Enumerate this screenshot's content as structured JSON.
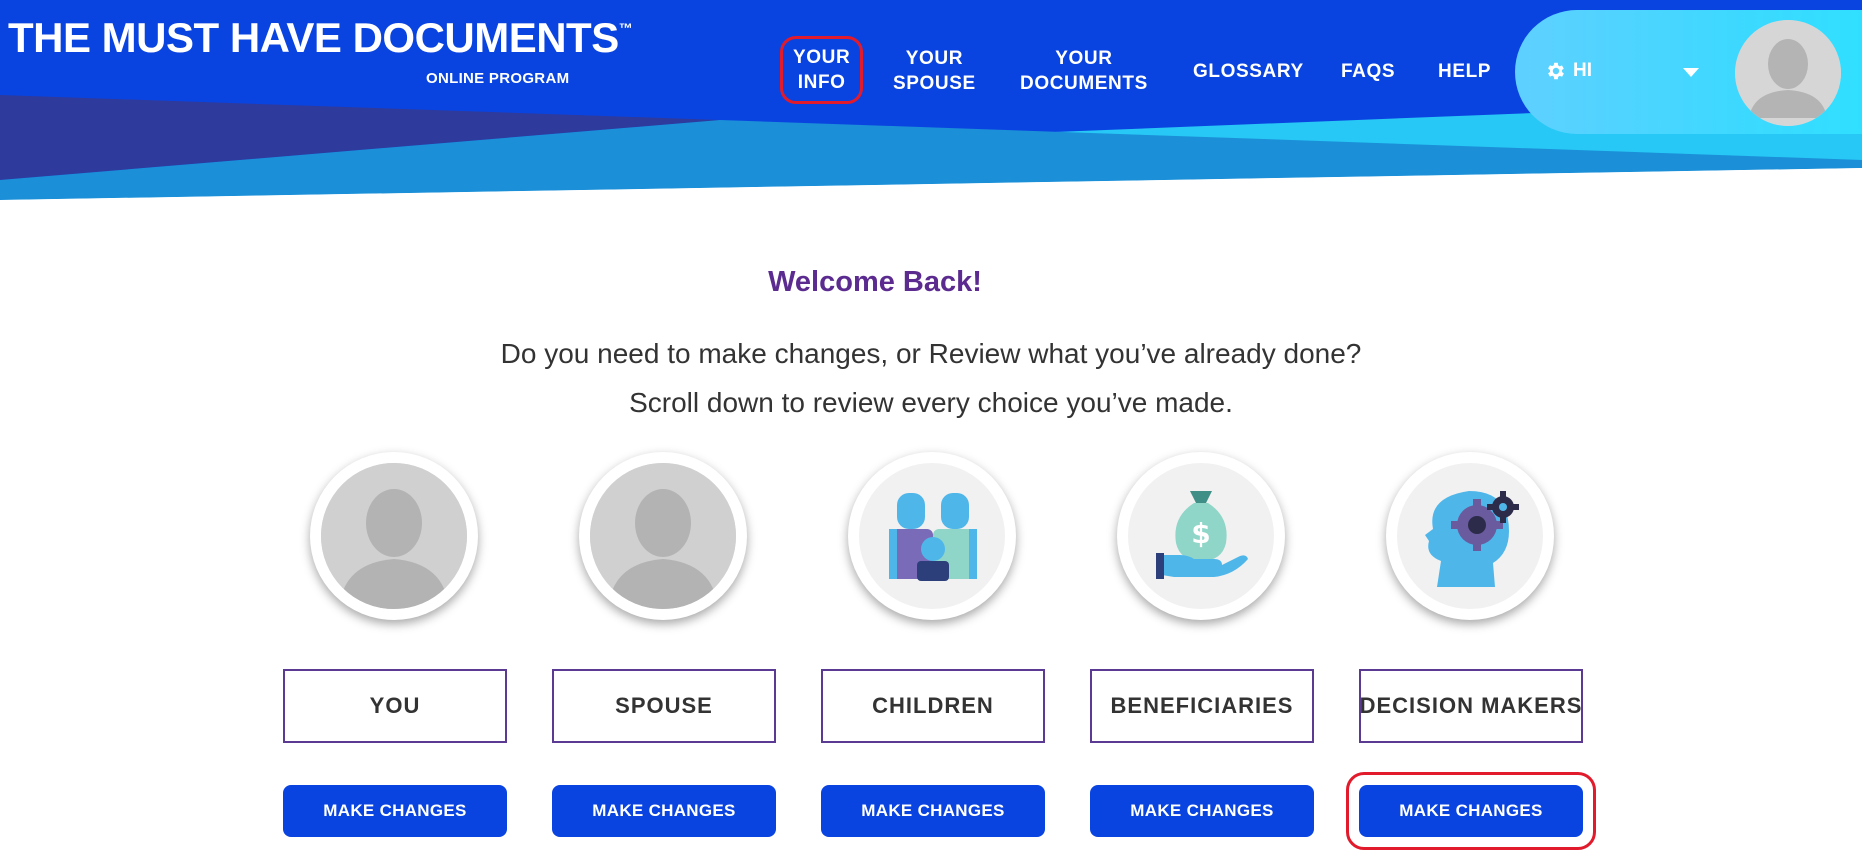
{
  "header": {
    "brand_title": "THE MUST HAVE DOCUMENTS",
    "brand_tm": "™",
    "brand_sub": "ONLINE PROGRAM",
    "nav": [
      {
        "line1": "YOUR",
        "line2": "INFO"
      },
      {
        "line1": "YOUR",
        "line2": "SPOUSE"
      },
      {
        "line1": "YOUR",
        "line2": "DOCUMENTS"
      },
      {
        "label": "GLOSSARY"
      },
      {
        "label": "FAQS"
      },
      {
        "label": "HELP"
      }
    ],
    "user_greeting": "HI",
    "colors": {
      "primary": "#0a44e0",
      "accent_cyan": "#2fd4ff",
      "highlight": "#e21b2c"
    }
  },
  "main": {
    "welcome": "Welcome Back!",
    "intro_line1": "Do you need to make changes, or Review what you’ve already done?",
    "intro_line2": "Scroll down to review every choice you’ve made.",
    "cards": [
      {
        "icon": "person-silhouette-icon",
        "label": "YOU",
        "button": "MAKE CHANGES"
      },
      {
        "icon": "person-silhouette-icon",
        "label": "SPOUSE",
        "button": "MAKE CHANGES"
      },
      {
        "icon": "family-icon",
        "label": "CHILDREN",
        "button": "MAKE CHANGES"
      },
      {
        "icon": "money-bag-hand-icon",
        "label": "BENEFICIARIES",
        "button": "MAKE CHANGES"
      },
      {
        "icon": "head-gear-icon",
        "label": "DECISION MAKERS",
        "button": "MAKE CHANGES"
      }
    ]
  }
}
